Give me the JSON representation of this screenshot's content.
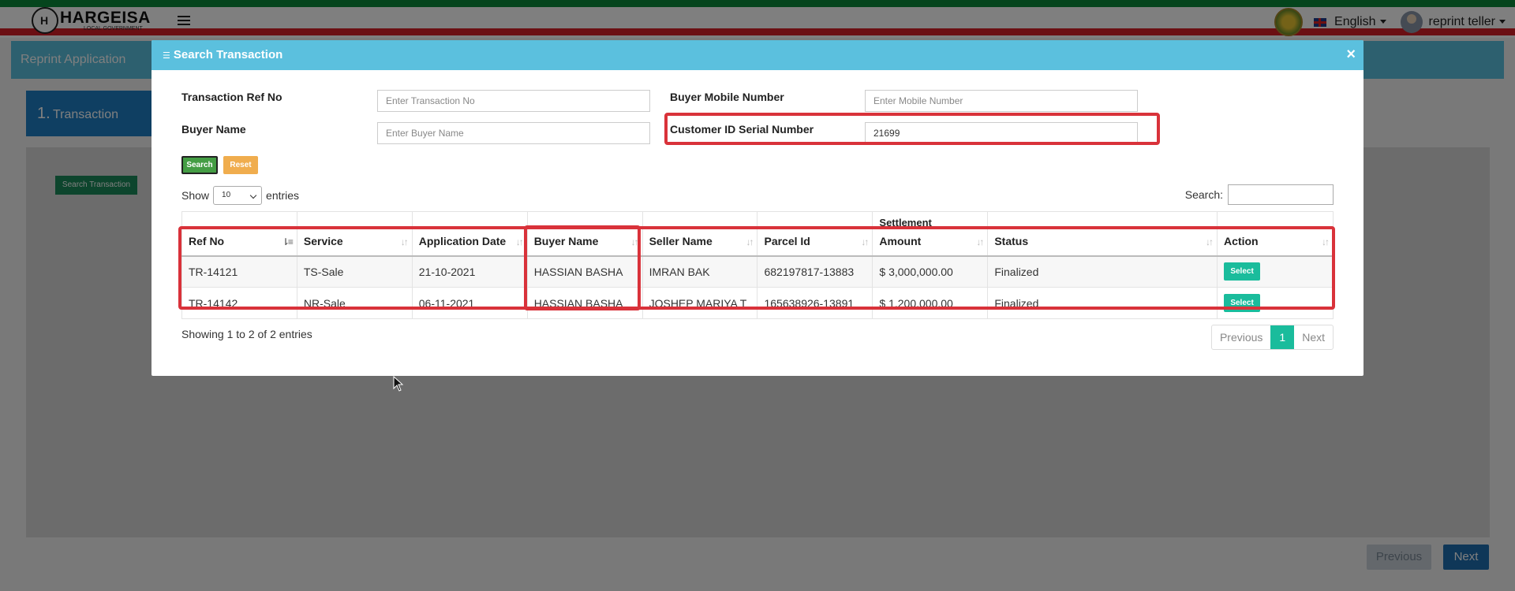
{
  "app": {
    "logo_title": "HARGEISA",
    "logo_subtitle": "LOCAL GOVERNMENT",
    "language": "English",
    "user": "reprint teller"
  },
  "page": {
    "header_title": "Reprint Application",
    "step_number": "1.",
    "step_label": "Transaction",
    "search_transaction_button": "Search Transaction",
    "previous_button": "Previous",
    "next_button": "Next"
  },
  "modal": {
    "title": "Search Transaction",
    "close": "×",
    "fields": {
      "transaction_ref_label": "Transaction Ref No",
      "transaction_ref_placeholder": "Enter Transaction No",
      "buyer_mobile_label": "Buyer Mobile Number",
      "buyer_mobile_placeholder": "Enter Mobile Number",
      "buyer_name_label": "Buyer Name",
      "buyer_name_placeholder": "Enter Buyer Name",
      "customer_id_label": "Customer ID Serial Number",
      "customer_id_value": "21699"
    },
    "search_button": "Search",
    "reset_button": "Reset",
    "show_label": "Show",
    "entries_value": "10",
    "entries_label": "entries",
    "search_label": "Search:",
    "table": {
      "headers": {
        "ref_no": "Ref No",
        "service": "Service",
        "application_date": "Application Date",
        "buyer_name": "Buyer Name",
        "seller_name": "Seller Name",
        "parcel_id": "Parcel Id",
        "settlement_top": "Settlement",
        "amount": "Amount",
        "status": "Status",
        "action": "Action"
      },
      "rows": [
        {
          "ref_no": "TR-14121",
          "service": "TS-Sale",
          "application_date": "21-10-2021",
          "buyer_name": "HASSIAN BASHA",
          "seller_name": "IMRAN BAK",
          "parcel_id": "682197817-13883",
          "amount": "$ 3,000,000.00",
          "status": "Finalized",
          "action": "Select"
        },
        {
          "ref_no": "TR-14142",
          "service": "NR-Sale",
          "application_date": "06-11-2021",
          "buyer_name": "HASSIAN BASHA",
          "seller_name": "JOSHEP MARIYA T",
          "parcel_id": "165638926-13891",
          "amount": "$ 1,200,000.00",
          "status": "Finalized",
          "action": "Select"
        }
      ]
    },
    "info": "Showing 1 to 2 of 2 entries",
    "pagination": {
      "previous": "Previous",
      "current": "1",
      "next": "Next"
    }
  },
  "colors": {
    "modal_header": "#5bc0de",
    "highlight": "#d9323a",
    "select_button": "#1abc9c",
    "search_button": "#449d44",
    "reset_button": "#f0ad4e"
  }
}
